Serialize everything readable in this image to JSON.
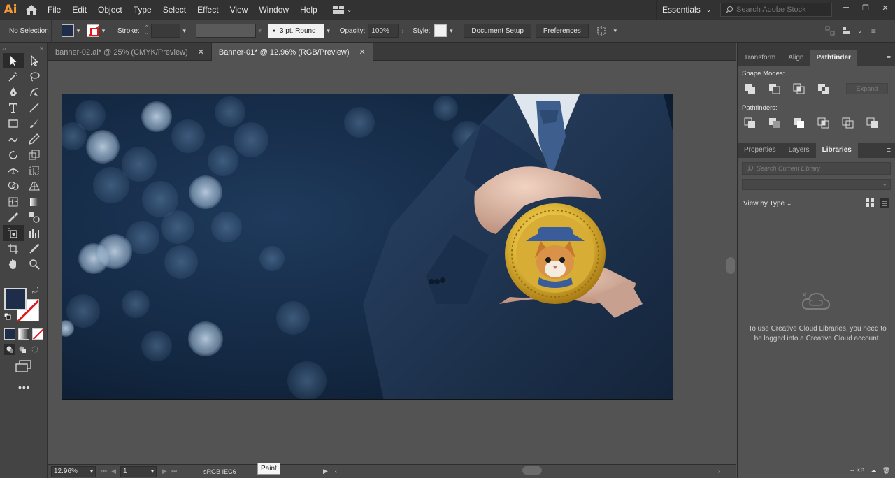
{
  "app": {
    "logo": "Ai"
  },
  "menu": [
    "File",
    "Edit",
    "Object",
    "Type",
    "Select",
    "Effect",
    "View",
    "Window",
    "Help"
  ],
  "workspace": {
    "label": "Essentials"
  },
  "stock_search": {
    "placeholder": "Search Adobe Stock"
  },
  "control_bar": {
    "selection_label": "No Selection",
    "stroke_label": "Stroke:",
    "brush_label": "3 pt. Round",
    "opacity_label": "Opacity:",
    "opacity_value": "100%",
    "style_label": "Style:",
    "document_setup": "Document Setup",
    "preferences": "Preferences"
  },
  "tabs": [
    {
      "label": "banner-02.ai* @ 25% (CMYK/Preview)",
      "close": "✕"
    },
    {
      "label": "Banner-01* @ 12.96% (RGB/Preview)",
      "close": "✕"
    }
  ],
  "status": {
    "zoom": "12.96%",
    "page": "1",
    "profile": "sRGB IEC6",
    "tooltip": "Paint"
  },
  "right_panel": {
    "top_tabs": [
      "Transform",
      "Align",
      "Pathfinder"
    ],
    "shape_modes_label": "Shape Modes:",
    "expand_label": "Expand",
    "pathfinders_label": "Pathfinders:",
    "bottom_tabs": [
      "Properties",
      "Layers",
      "Libraries"
    ],
    "search_placeholder": "Search Current Library",
    "view_by": "View by Type",
    "message": "To use Creative Cloud Libraries, you need to be logged into a Creative Cloud account.",
    "footer_kb": "-- KB"
  },
  "colors": {
    "fill": "#1e2e4a",
    "stroke_none": "#e0161b",
    "ai_brand": "#f29a35",
    "coin_gold": "#e0b83a"
  }
}
